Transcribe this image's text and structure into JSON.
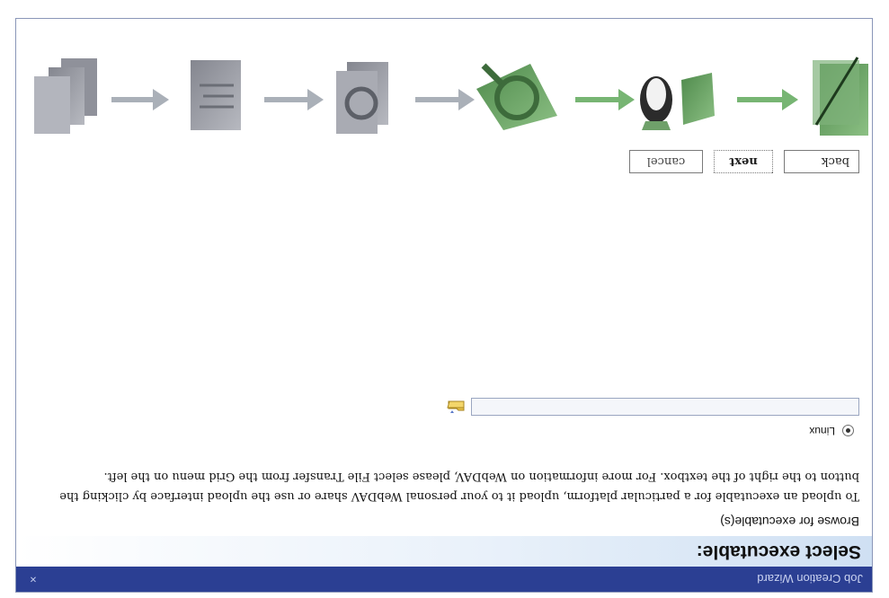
{
  "window": {
    "title": "Job Creation Wizard",
    "close_glyph": "×"
  },
  "step": {
    "heading": "Select executable:",
    "subheading": "Browse for executable(s)",
    "description": "To upload an executable for a particular platform, upload it to your personal WebDAV share or use the upload interface by clicking the button to the right of the textbox. For more information on WebDAV, please select File Transfer from the Grid menu on the left.",
    "platform_label": "Linux",
    "file_value": ""
  },
  "nav": {
    "back": "back",
    "next": "next",
    "cancel": "cancel"
  },
  "wizard_icons": [
    "browse-step-icon",
    "platform-step-icon",
    "search-step-icon",
    "inspect-step-icon",
    "edit-step-icon",
    "output-step-icon"
  ],
  "colors": {
    "titlebar": "#2b3f93",
    "active_step": "#6fa06a",
    "inactive_step": "#9a9ca5"
  }
}
